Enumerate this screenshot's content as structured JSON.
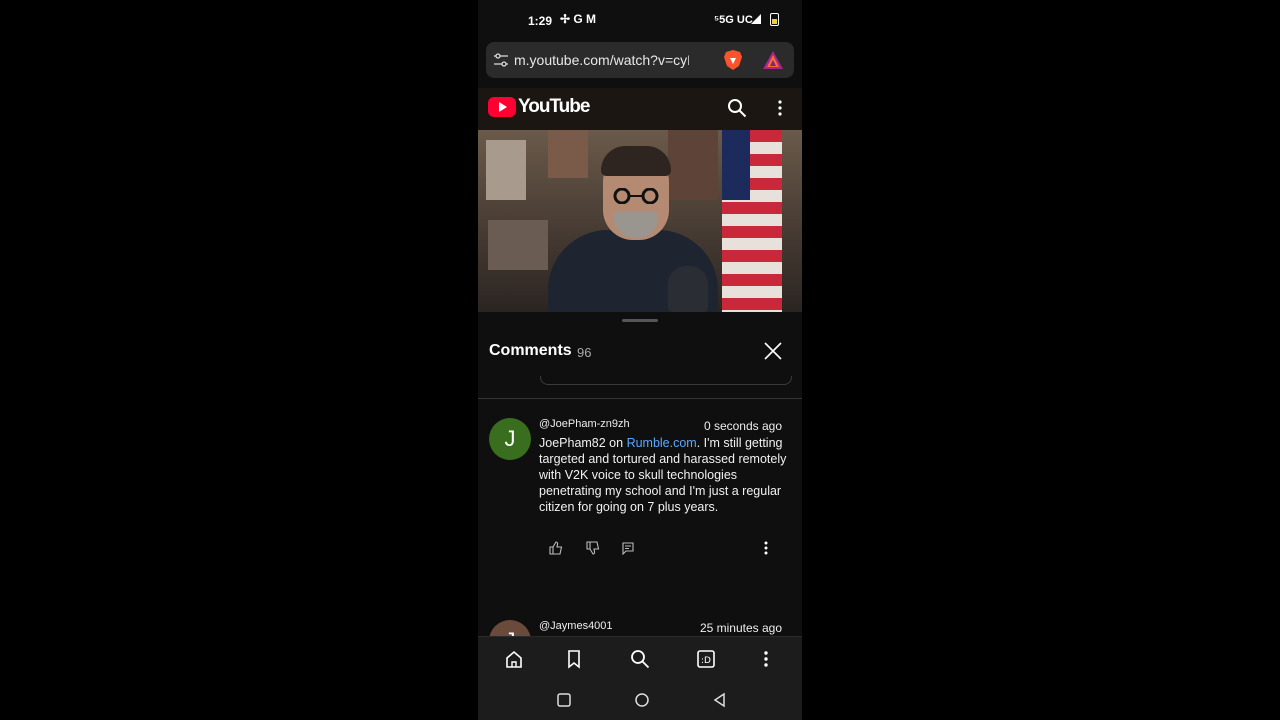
{
  "status_bar": {
    "time": "1:29",
    "icons": "✢ G M",
    "network": "⁵5G UC"
  },
  "browser": {
    "url": "m.youtube.com/watch?v=cyHq"
  },
  "youtube": {
    "logo_text": "YouTube"
  },
  "comments_panel": {
    "title": "Comments",
    "count": "96",
    "comments": [
      {
        "author": "@JoePham-zn9zh",
        "time_ago": "0 seconds ago",
        "avatar_letter": "J",
        "avatar_color": "#3a6e1f",
        "text_before_link": "JoePham82 on ",
        "link_text": "Rumble.com",
        "text_after_link": ". I'm still getting targeted and tortured and harassed remotely with V2K voice to skull technologies penetrating my school and I'm just a regular citizen for going on 7 plus years."
      },
      {
        "author": "@Jaymes4001",
        "time_ago": "25 minutes ago",
        "avatar_letter": "J",
        "avatar_color": "#6a4a3a"
      }
    ]
  },
  "colors": {
    "accent_link": "#5aa8ff",
    "youtube_red": "#ff0033"
  }
}
